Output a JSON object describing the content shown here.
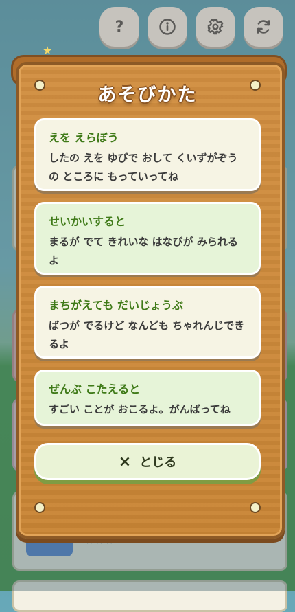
{
  "top_buttons": {
    "help_label": "?",
    "info_label": "i"
  },
  "dialog": {
    "title": "あそびかた",
    "sections": [
      {
        "heading": "えを えらぼう",
        "body": "したの えを ゆびで おして くいずがぞうの ところに もっていってね",
        "bg": "#f6f4e4"
      },
      {
        "heading": "せいかいすると",
        "body": "まるが でて きれいな はなびが みられるよ",
        "bg": "#e6f4d8"
      },
      {
        "heading": "まちがえても だいじょうぶ",
        "body": "ばつが でるけど なんども ちゃれんじできるよ",
        "bg": "#f6f4e4"
      },
      {
        "heading": "ぜんぶ こたえると",
        "body": "すごい ことが おこるよ。がんばってね",
        "bg": "#e6f4d8"
      }
    ],
    "close_icon": "×",
    "close_label": "とじる"
  },
  "colors": {
    "heading": "#3f7a18",
    "wood": "#c98535",
    "close_bg": "#eaf3d6"
  }
}
